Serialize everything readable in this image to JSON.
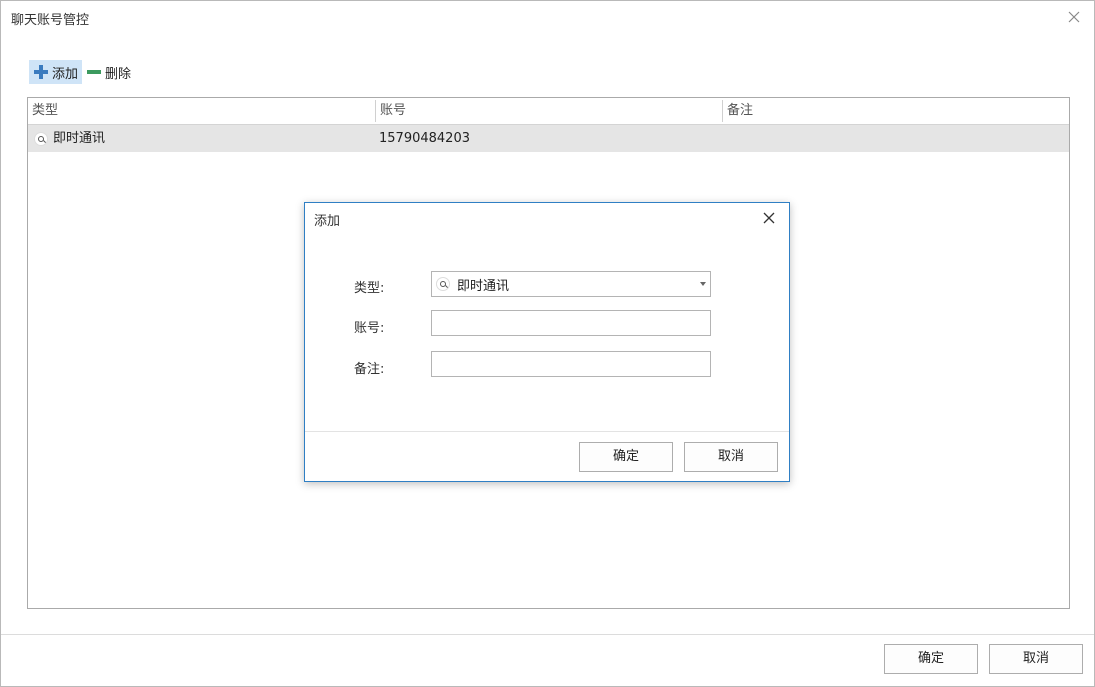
{
  "window": {
    "title": "聊天账号管控"
  },
  "toolbar": {
    "add_label": "添加",
    "delete_label": "删除"
  },
  "grid": {
    "columns": [
      "类型",
      "账号",
      "备注"
    ],
    "rows": [
      {
        "type": "即时通讯",
        "account": "15790484203",
        "note": ""
      }
    ]
  },
  "footer": {
    "ok_label": "确定",
    "cancel_label": "取消"
  },
  "dialog": {
    "title": "添加",
    "type_label": "类型:",
    "type_value": "即时通讯",
    "account_label": "账号:",
    "account_value": "",
    "note_label": "备注:",
    "note_value": "",
    "ok_label": "确定",
    "cancel_label": "取消"
  },
  "colors": {
    "accent_border": "#2f7fc4",
    "selected_row": "#e5e5e5",
    "add_icon": "#3a7bbf",
    "delete_icon": "#3c9a5f"
  }
}
